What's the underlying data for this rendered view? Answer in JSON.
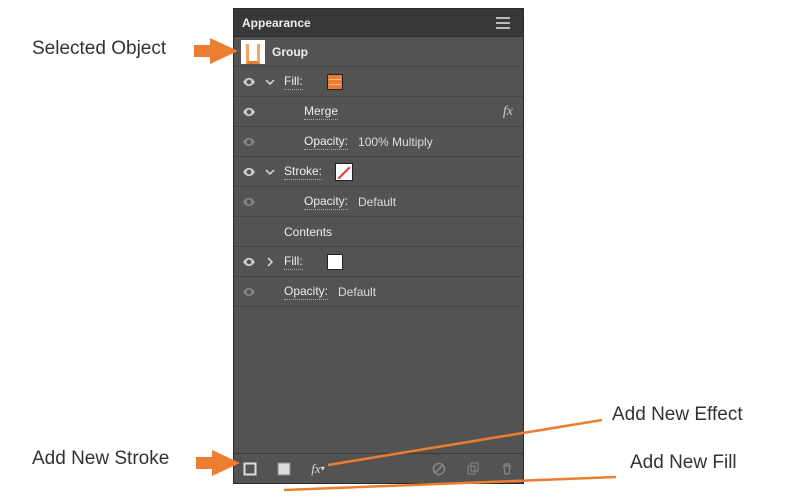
{
  "panel": {
    "title": "Appearance",
    "groupLabel": "Group",
    "rows": {
      "fill1": {
        "label": "Fill:"
      },
      "merge": {
        "label": "Merge"
      },
      "opacity1": {
        "label": "Opacity:",
        "value": "100% Multiply"
      },
      "stroke": {
        "label": "Stroke:"
      },
      "opacity2": {
        "label": "Opacity:",
        "value": "Default"
      },
      "contents": {
        "label": "Contents"
      },
      "fill2": {
        "label": "Fill:"
      },
      "opacity3": {
        "label": "Opacity:",
        "value": "Default"
      }
    },
    "footer": {
      "addStroke": "Add New Stroke",
      "addFill": "Add New Fill",
      "addEffect": "fx"
    }
  },
  "callouts": {
    "selectedObject": "Selected Object",
    "addNewStroke": "Add New Stroke",
    "addNewEffect": "Add New Effect",
    "addNewFill": "Add New Fill"
  }
}
